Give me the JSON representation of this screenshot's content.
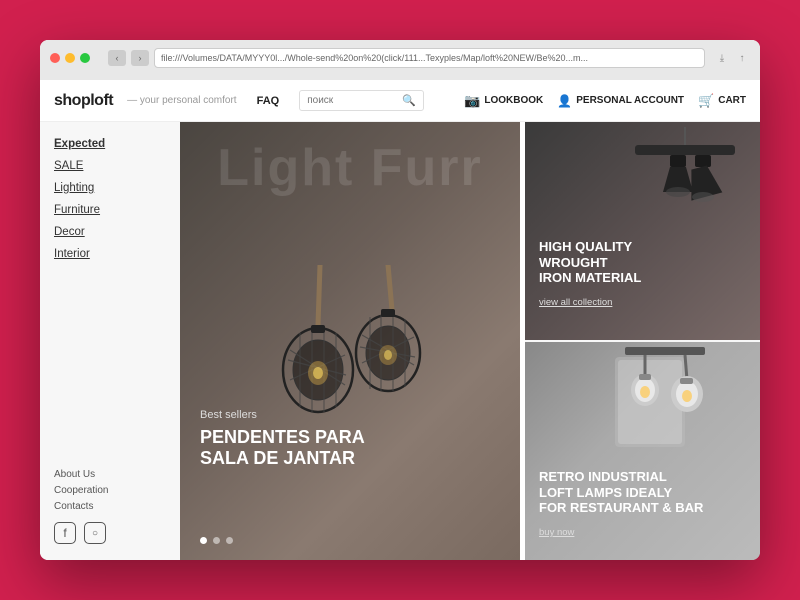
{
  "browser": {
    "address": "file:///Volumes/DATA/MYYY0l.../Whole-send%20on%20(click/111...Texyples/Map/loft%20NEW/Be%20...m..."
  },
  "header": {
    "logo": "shoploft",
    "tagline": "— your personal comfort",
    "nav_faq": "FAQ",
    "search_placeholder": "поиск",
    "lookbook": "LOOKBOOK",
    "personal_account": "PERSONAL ACCOUNT",
    "cart": "CART"
  },
  "sidebar": {
    "items": [
      {
        "label": "Expected",
        "active": true
      },
      {
        "label": "SALE"
      },
      {
        "label": "Lighting"
      },
      {
        "label": "Furniture"
      },
      {
        "label": "Decor"
      },
      {
        "label": "Interior"
      }
    ],
    "footer_links": [
      "About Us",
      "Cooperation",
      "Contacts"
    ],
    "social": [
      "f",
      "IG"
    ]
  },
  "hero": {
    "big_text": "Light  Furr",
    "tag": "Best sellers",
    "title_line1": "PENDENTES PARA",
    "title_line2": "SALA DE JANTAR"
  },
  "panel_top": {
    "heading_line1": "HIGH QUALITY",
    "heading_line2": "WROUGHT",
    "heading_line3": "IRON MATERIAL",
    "link": "view all collection"
  },
  "panel_bottom": {
    "heading_line1": "RETRO INDUSTRIAL",
    "heading_line2": "LOFT LAMPS IDEALY",
    "heading_line3": "FOR RESTAURANT & BAR",
    "link": "buy now"
  },
  "dots": [
    "active",
    "inactive",
    "inactive"
  ]
}
